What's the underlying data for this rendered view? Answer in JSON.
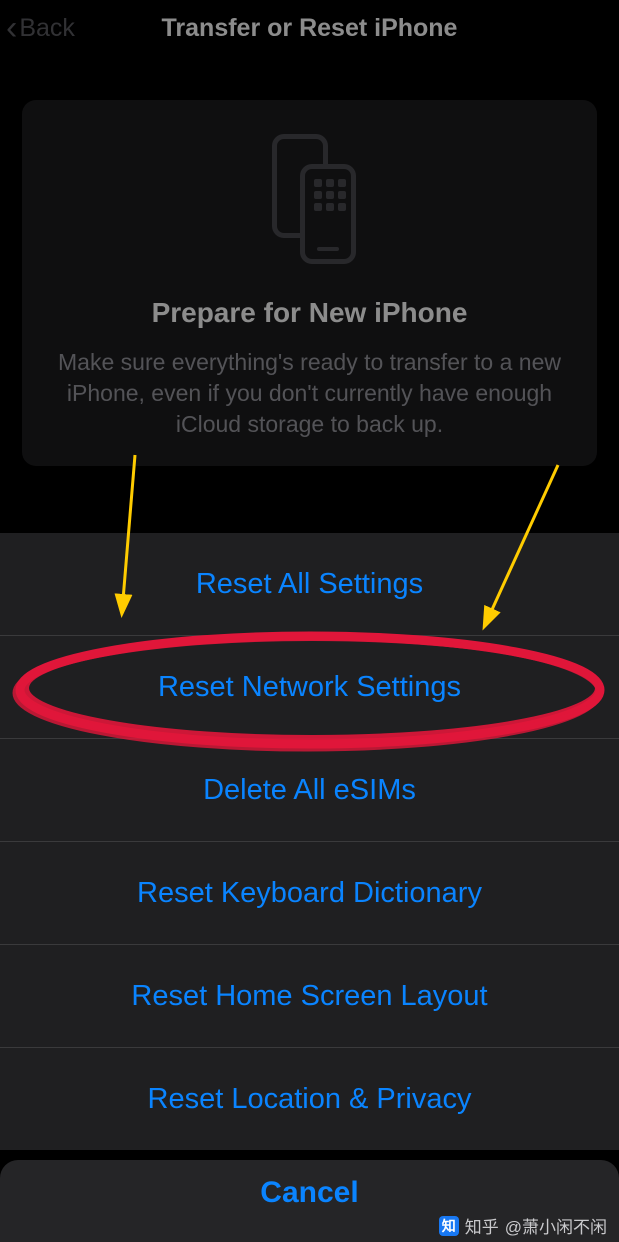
{
  "nav": {
    "back_label": "Back",
    "title": "Transfer or Reset iPhone"
  },
  "prepare": {
    "title": "Prepare for New iPhone",
    "description": "Make sure everything's ready to transfer to a new iPhone, even if you don't currently have enough iCloud storage to back up."
  },
  "sheet": {
    "items": [
      "Reset All Settings",
      "Reset Network Settings",
      "Delete All eSIMs",
      "Reset Keyboard Dictionary",
      "Reset Home Screen Layout",
      "Reset Location & Privacy"
    ],
    "cancel": "Cancel"
  },
  "annotation": {
    "circle_color": "#e0163a",
    "arrow_color": "#ffcc00",
    "highlighted_index": 1
  },
  "watermark": {
    "brand": "知乎",
    "text": "@萧小闲不闲"
  }
}
